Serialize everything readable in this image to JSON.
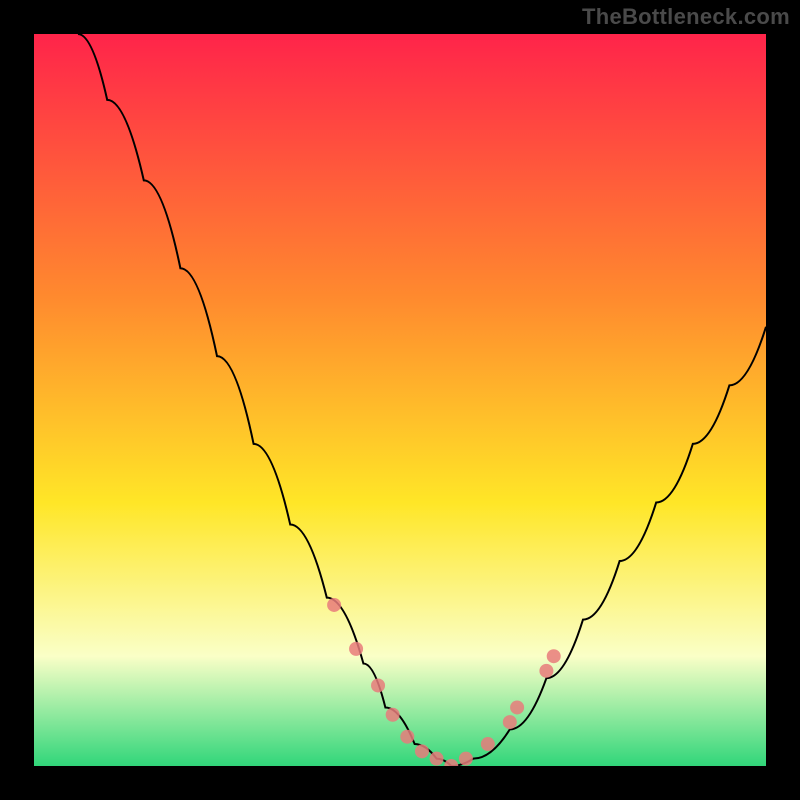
{
  "watermark": "TheBottleneck.com",
  "chart_data": {
    "type": "line",
    "title": "",
    "xlabel": "",
    "ylabel": "",
    "xlim": [
      0,
      100
    ],
    "ylim": [
      0,
      100
    ],
    "background_gradient": {
      "top": "#ff244a",
      "mid1": "#ff8a2e",
      "mid2": "#ffe627",
      "mid3": "#faffc7",
      "bottom": "#31d67a"
    },
    "series": [
      {
        "name": "bottleneck-v-curve",
        "type": "line",
        "color": "#000000",
        "x": [
          6,
          10,
          15,
          20,
          25,
          30,
          35,
          40,
          45,
          48,
          52,
          55,
          57,
          60,
          65,
          70,
          75,
          80,
          85,
          90,
          95,
          100
        ],
        "y": [
          100,
          91,
          80,
          68,
          56,
          44,
          33,
          23,
          14,
          8,
          3,
          1,
          0,
          1,
          5,
          12,
          20,
          28,
          36,
          44,
          52,
          60
        ]
      },
      {
        "name": "sweet-spot-markers",
        "type": "scatter",
        "color": "#e77b7b",
        "x": [
          41,
          44,
          47,
          49,
          51,
          53,
          55,
          57,
          59,
          62,
          65,
          66,
          70,
          71
        ],
        "y": [
          22,
          16,
          11,
          7,
          4,
          2,
          1,
          0,
          1,
          3,
          6,
          8,
          13,
          15
        ]
      }
    ]
  },
  "colors": {
    "frame": "#000000",
    "curve": "#000000",
    "marker": "#e77b7b",
    "watermark": "#4a4a4a"
  }
}
